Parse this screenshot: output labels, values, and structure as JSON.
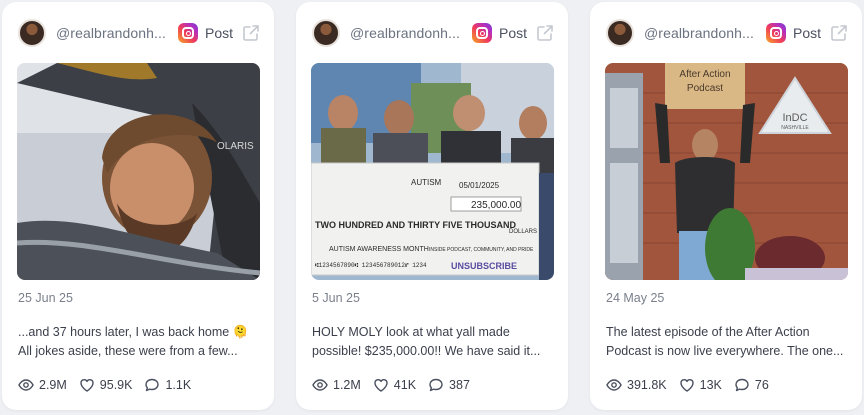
{
  "cards": [
    {
      "handle": "@realbrandonh...",
      "platform_icon": "instagram-icon",
      "post_label": "Post",
      "date": "25 Jun 25",
      "caption_line1": "...and 37 hours later, I was back home 🫠",
      "caption_line2": "All jokes aside, these were from a few...",
      "views": "2.9M",
      "likes": "95.9K",
      "comments": "1.1K",
      "image_text": "OLARIS"
    },
    {
      "handle": "@realbrandonh...",
      "platform_icon": "instagram-icon",
      "post_label": "Post",
      "date": "5 Jun 25",
      "caption_line1": "HOLY MOLY look at what yall made",
      "caption_line2": "possible! $235,000.00!! We have said it...",
      "views": "1.2M",
      "likes": "41K",
      "comments": "387",
      "image_text": {
        "check_date": "05/01/2025",
        "check_amount": "235,000.00",
        "check_words": "TWO HUNDRED AND THIRTY FIVE THOUSAND",
        "check_memo": "AUTISM AWARENESS MONTH",
        "check_brand": "UNSUBSCRIBE",
        "check_payee": "AUTISM",
        "check_dollars": "DOLLARS",
        "check_micr": "⑆1234567890⑆ 123456789012⑈ 1234",
        "check_note": "INSIDE PODCAST, COMMUNITY, AND PRIDE"
      }
    },
    {
      "handle": "@realbrandonh...",
      "platform_icon": "instagram-icon",
      "post_label": "Post",
      "date": "24 May 25",
      "caption_line1": "The latest episode of the After Action",
      "caption_line2": "Podcast is now live everywhere. The one...",
      "views": "391.8K",
      "likes": "13K",
      "comments": "76",
      "image_text": {
        "sign_line1": "After Action",
        "sign_line2": "Podcast",
        "logo_line1": "InDC",
        "logo_line2": "NASHVILLE"
      }
    }
  ],
  "colors": {
    "background": "#eef0f4",
    "card": "#ffffff",
    "text": "#3a3f4b",
    "muted": "#7a808c"
  }
}
